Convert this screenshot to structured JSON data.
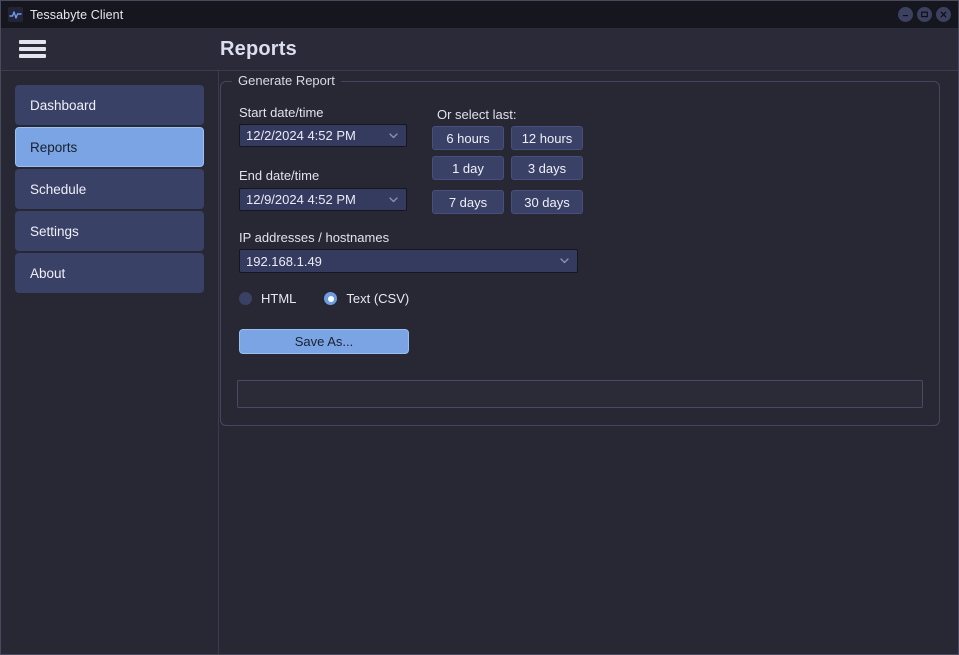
{
  "window": {
    "title": "Tessabyte Client",
    "app_icon": "pulse-icon",
    "controls": [
      {
        "name": "minimize",
        "glyph": "–"
      },
      {
        "name": "maximize",
        "glyph": "▭"
      },
      {
        "name": "close",
        "glyph": "✕"
      }
    ]
  },
  "header": {
    "menu_icon": "hamburger-menu-icon",
    "title": "Reports"
  },
  "sidebar": {
    "items": [
      {
        "label": "Dashboard",
        "active": false
      },
      {
        "label": "Reports",
        "active": true
      },
      {
        "label": "Schedule",
        "active": false
      },
      {
        "label": "Settings",
        "active": false
      },
      {
        "label": "About",
        "active": false
      }
    ]
  },
  "main": {
    "group_legend": "Generate Report",
    "start_label": "Start date/time",
    "start_value": "12/2/2024 4:52 PM",
    "end_label": "End date/time",
    "end_value": "12/9/2024 4:52 PM",
    "quick_label": "Or select last:",
    "quick_buttons": [
      "6 hours",
      "12 hours",
      "1 day",
      "3 days",
      "7 days",
      "30 days"
    ],
    "ip_label": "IP addresses / hostnames",
    "ip_value": "192.168.1.49",
    "format_options": [
      {
        "label": "HTML",
        "selected": false
      },
      {
        "label": "Text (CSV)",
        "selected": true
      }
    ],
    "save_button": "Save As...",
    "status_text": ""
  },
  "colors": {
    "accent": "#7aa4e3",
    "nav": "#3a4167",
    "window_bg": "#282834",
    "titlebar_bg": "#16161f",
    "field_bg": "#353b5e"
  }
}
